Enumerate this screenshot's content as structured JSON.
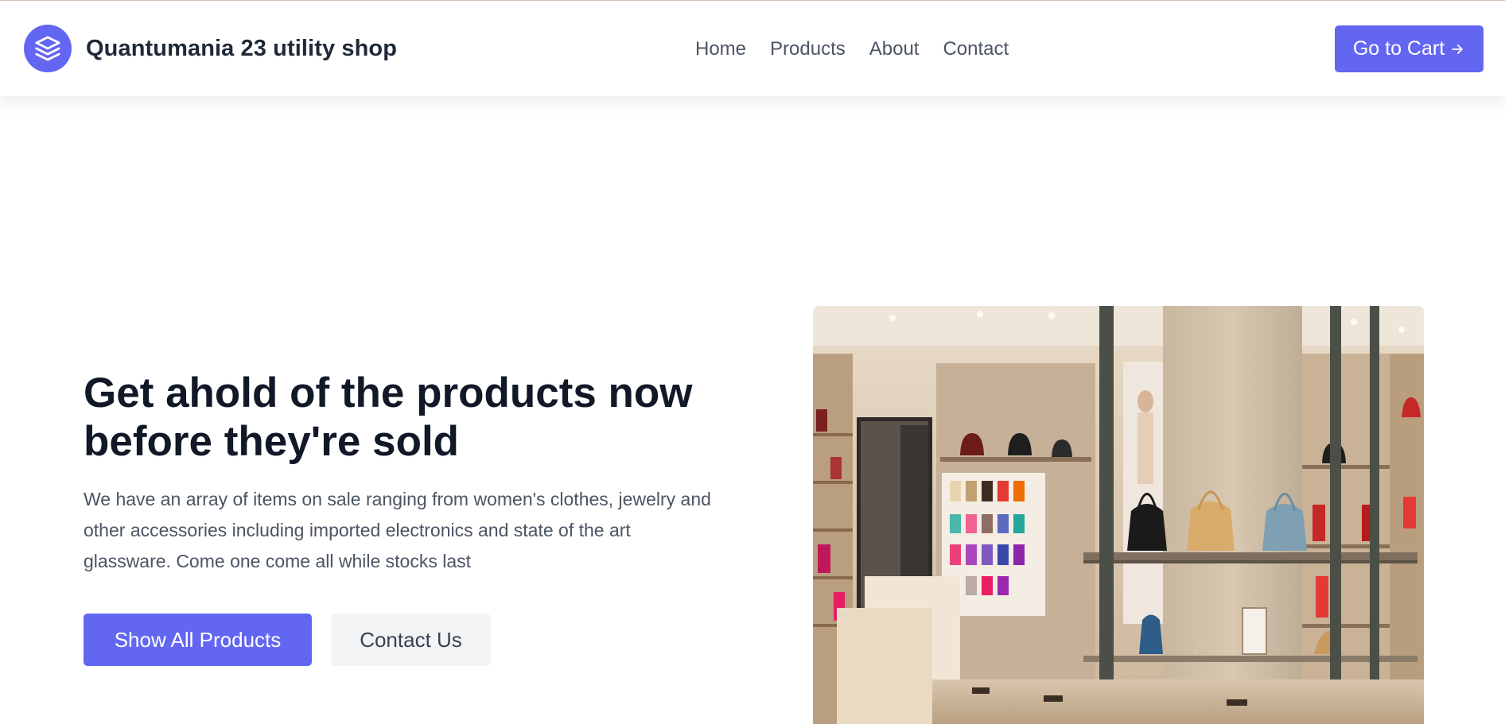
{
  "header": {
    "brand_name": "Quantumania 23 utility shop",
    "logo_icon": "stacked-layers-icon",
    "nav": [
      "Home",
      "Products",
      "About",
      "Contact"
    ],
    "cart_button": "Go to Cart",
    "cart_icon": "arrow-right-icon"
  },
  "hero": {
    "title": "Get ahold of the products now before they're sold",
    "description": "We have an array of items on sale ranging from women's clothes, jewelry and other accessories including imported electronics and state of the art glassware. Come one come all while stocks last",
    "primary_button": "Show All Products",
    "secondary_button": "Contact Us",
    "image": "boutique-interior-with-handbags-and-shoes"
  },
  "colors": {
    "accent": "#6366f1",
    "title_text": "#111827",
    "body_text": "#4b5563",
    "secondary_button_bg": "#f3f4f6"
  }
}
